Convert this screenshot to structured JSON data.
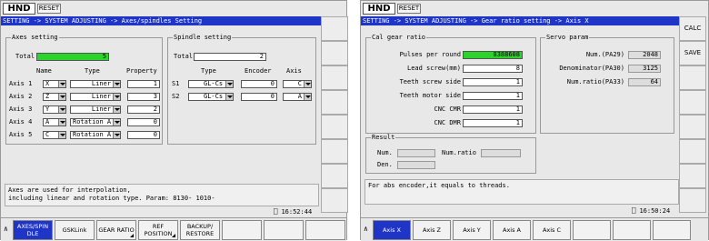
{
  "left": {
    "logo": "HND",
    "reset": "RESET",
    "path": "SETTING -> SYSTEM ADJUSTING -> Axes/spindles Setting",
    "axes_group": {
      "legend": "Axes setting",
      "total_label": "Total",
      "total_value": "5",
      "headers": {
        "name": "Name",
        "type": "Type",
        "property": "Property"
      },
      "rows": [
        {
          "label": "Axis 1",
          "name": "X",
          "type": "Liner",
          "property": "1"
        },
        {
          "label": "Axis 2",
          "name": "Z",
          "type": "Liner",
          "property": "3"
        },
        {
          "label": "Axis 3",
          "name": "Y",
          "type": "Liner",
          "property": "2"
        },
        {
          "label": "Axis 4",
          "name": "A",
          "type": "Rotation A",
          "property": "0"
        },
        {
          "label": "Axis 5",
          "name": "C",
          "type": "Rotation A",
          "property": "0"
        }
      ]
    },
    "spindle_group": {
      "legend": "Spindle setting",
      "total_label": "Total",
      "total_value": "2",
      "headers": {
        "type": "Type",
        "encoder": "Encoder",
        "axis": "Axis"
      },
      "rows": [
        {
          "label": "S1",
          "type": "GL-Cs",
          "encoder": "0",
          "axis": "C"
        },
        {
          "label": "S2",
          "type": "GL-Cs",
          "encoder": "0",
          "axis": "A"
        }
      ]
    },
    "message": [
      "Axes are used for interpolation,",
      "including linear and rotation type. Param: 8130- 1010-"
    ],
    "clock": "16:52:44",
    "softkeys": [
      "AXES/SPIN DLE",
      "GSKLink",
      "GEAR RATIO",
      "REF POSITION",
      "BACKUP/ RESTORE"
    ]
  },
  "right": {
    "logo": "HND",
    "reset": "RESET",
    "path": "SETTING -> SYSTEM ADJUSTING -> Gear ratio setting -> Axis X",
    "side_buttons": [
      "CALC",
      "SAVE"
    ],
    "cal_group": {
      "legend": "Cal gear ratio",
      "rows": [
        {
          "label": "Pulses per round",
          "value": "8388608"
        },
        {
          "label": "Lead screw(mm)",
          "value": "8"
        },
        {
          "label": "Teeth screw side",
          "value": "1"
        },
        {
          "label": "Teeth motor side",
          "value": "1"
        },
        {
          "label": "CNC CMR",
          "value": "1"
        },
        {
          "label": "CNC DMR",
          "value": "1"
        }
      ]
    },
    "servo_group": {
      "legend": "Servo param",
      "rows": [
        {
          "label": "Num.(PA29)",
          "value": "2048"
        },
        {
          "label": "Denominator(PA30)",
          "value": "3125"
        },
        {
          "label": "Num.ratio(PA33)",
          "value": "64"
        }
      ]
    },
    "result_group": {
      "legend": "Result",
      "num_label": "Num.",
      "den_label": "Den.",
      "ratio_label": "Num.ratio"
    },
    "message": "For abs encoder,it equals to threads.",
    "clock": "16:50:24",
    "softkeys": [
      "Axis X",
      "Axis Z",
      "Axis Y",
      "Axis A",
      "Axis C"
    ]
  },
  "colors": {
    "title_bar": "#1e35c8",
    "highlight_green": "#2ad42a",
    "panel": "#e8e8e8"
  }
}
